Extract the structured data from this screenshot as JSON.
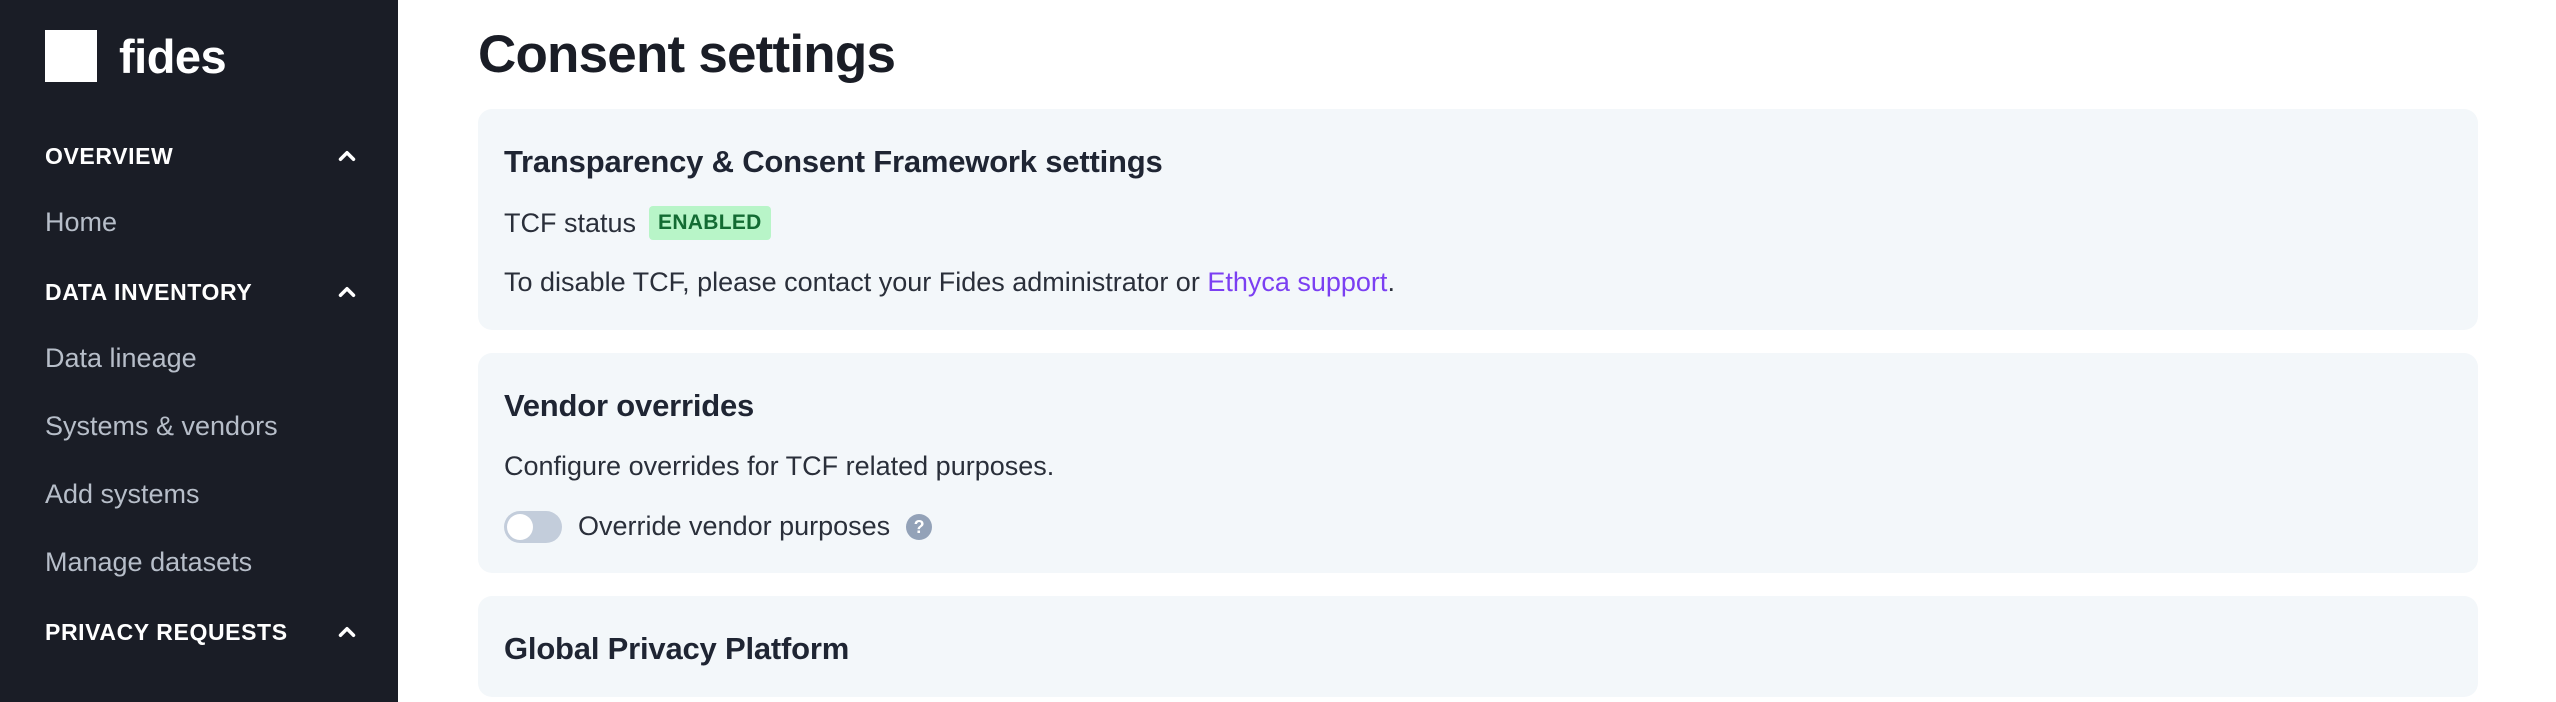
{
  "sidebar": {
    "logo": {
      "mark": "square-logo-mark",
      "text": "fides"
    },
    "groups": [
      {
        "title": "OVERVIEW",
        "chevron": "chevron-up-icon",
        "items": [
          {
            "label": "Home"
          }
        ]
      },
      {
        "title": "DATA INVENTORY",
        "chevron": "chevron-up-icon",
        "items": [
          {
            "label": "Data lineage"
          },
          {
            "label": "Systems & vendors"
          },
          {
            "label": "Add systems"
          },
          {
            "label": "Manage datasets"
          }
        ]
      },
      {
        "title": "PRIVACY REQUESTS",
        "chevron": "chevron-up-icon",
        "items": []
      }
    ]
  },
  "main": {
    "page_title": "Consent settings",
    "cards": {
      "tcf": {
        "title": "Transparency & Consent Framework settings",
        "status_label": "TCF status",
        "status_badge": "ENABLED",
        "note_prefix": "To disable TCF, please contact your Fides administrator or ",
        "note_link": "Ethyca support",
        "note_suffix": "."
      },
      "vendor_overrides": {
        "title": "Vendor overrides",
        "description": "Configure overrides for TCF related purposes.",
        "toggle_label": "Override vendor purposes",
        "toggle_state": "off",
        "help_icon": "?"
      },
      "gpp": {
        "title": "Global Privacy Platform"
      }
    }
  },
  "colors": {
    "sidebar_bg": "#1a1d26",
    "card_bg": "#f3f7fa",
    "badge_bg": "#b8f5c8",
    "badge_text": "#136b33",
    "link": "#7b3ff2",
    "toggle_track": "#c3cddb"
  }
}
